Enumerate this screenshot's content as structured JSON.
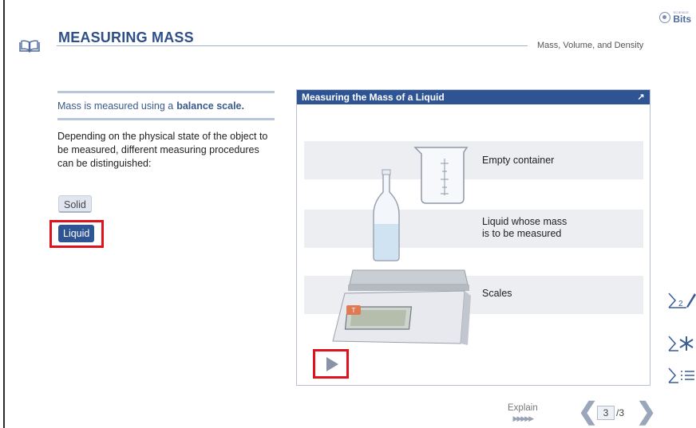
{
  "header": {
    "title": "MEASURING MASS",
    "subtitle": "Mass, Volume, and Density",
    "logo_small": "SCIENCE",
    "logo_big": "Bits"
  },
  "left": {
    "lead_prefix": "Mass is measured using a",
    "lead_bold": "balance scale.",
    "body": "Depending on the physical state of the object to be measured, different measuring procedures can be distinguished:",
    "options": [
      {
        "label": "Solid"
      },
      {
        "label": "Liquid"
      }
    ]
  },
  "panel": {
    "title": "Measuring the Mass of a Liquid",
    "captions": {
      "container": "Empty container",
      "liquid_line1": "Liquid whose mass",
      "liquid_line2": "is to be measured",
      "scales": "Scales"
    },
    "scale_button_label": "T"
  },
  "side_tools": {
    "notes_number": "2"
  },
  "footer": {
    "explain_label": "Explain",
    "page_current": "3",
    "page_total": "/3"
  },
  "colors": {
    "accent": "#2f5493",
    "highlight": "#e0121b",
    "rule": "#b9c7dd"
  }
}
